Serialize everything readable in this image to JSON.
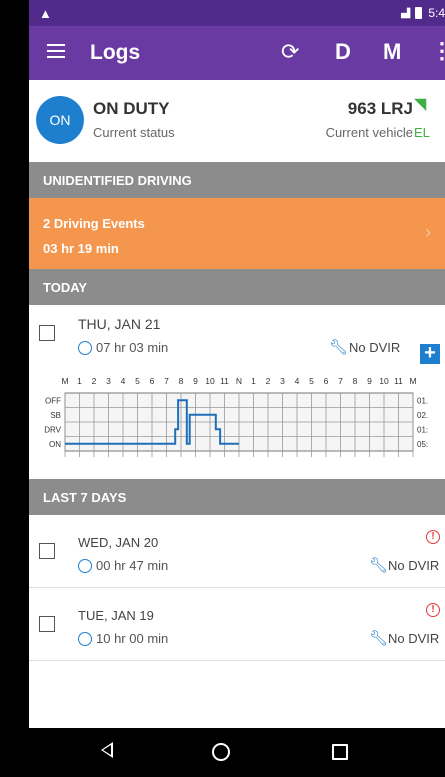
{
  "statusbar": {
    "clock": "5:4"
  },
  "appbar": {
    "title": "Logs",
    "d_label": "D",
    "m_label": "M"
  },
  "status": {
    "badge": "ON",
    "duty": "ON DUTY",
    "duty_sub": "Current status",
    "vehicle": "963 LRJ",
    "vehicle_sub": "Current vehicle",
    "eld": "EL"
  },
  "unidentified": {
    "section": "UNIDENTIFIED DRIVING",
    "events": "2 Driving Events",
    "duration": "03 hr 19 min"
  },
  "today": {
    "section": "TODAY",
    "date": "THU, JAN 21",
    "duration": "07 hr 03 min",
    "dvir": "No DVIR",
    "graph": {
      "hour_labels": [
        "M",
        "1",
        "2",
        "3",
        "4",
        "5",
        "6",
        "7",
        "8",
        "9",
        "10",
        "11",
        "N",
        "1",
        "2",
        "3",
        "4",
        "5",
        "6",
        "7",
        "8",
        "9",
        "10",
        "11",
        "M"
      ],
      "row_labels": [
        "OFF",
        "SB",
        "DRV",
        "ON"
      ],
      "totals": [
        "01.",
        "02.",
        "01:",
        "05:"
      ]
    }
  },
  "last7": {
    "section": "LAST 7 DAYS",
    "items": [
      {
        "date": "WED, JAN 20",
        "duration": "00 hr 47 min",
        "dvir": "No DVIR"
      },
      {
        "date": "TUE, JAN 19",
        "duration": "10 hr 00 min",
        "dvir": "No DVIR"
      }
    ]
  },
  "colors": {
    "primary": "#6a3aa3",
    "status_bar": "#512a8c",
    "accent": "#1f7fcf",
    "alert": "#f4964d",
    "eld": "#3cb043"
  }
}
